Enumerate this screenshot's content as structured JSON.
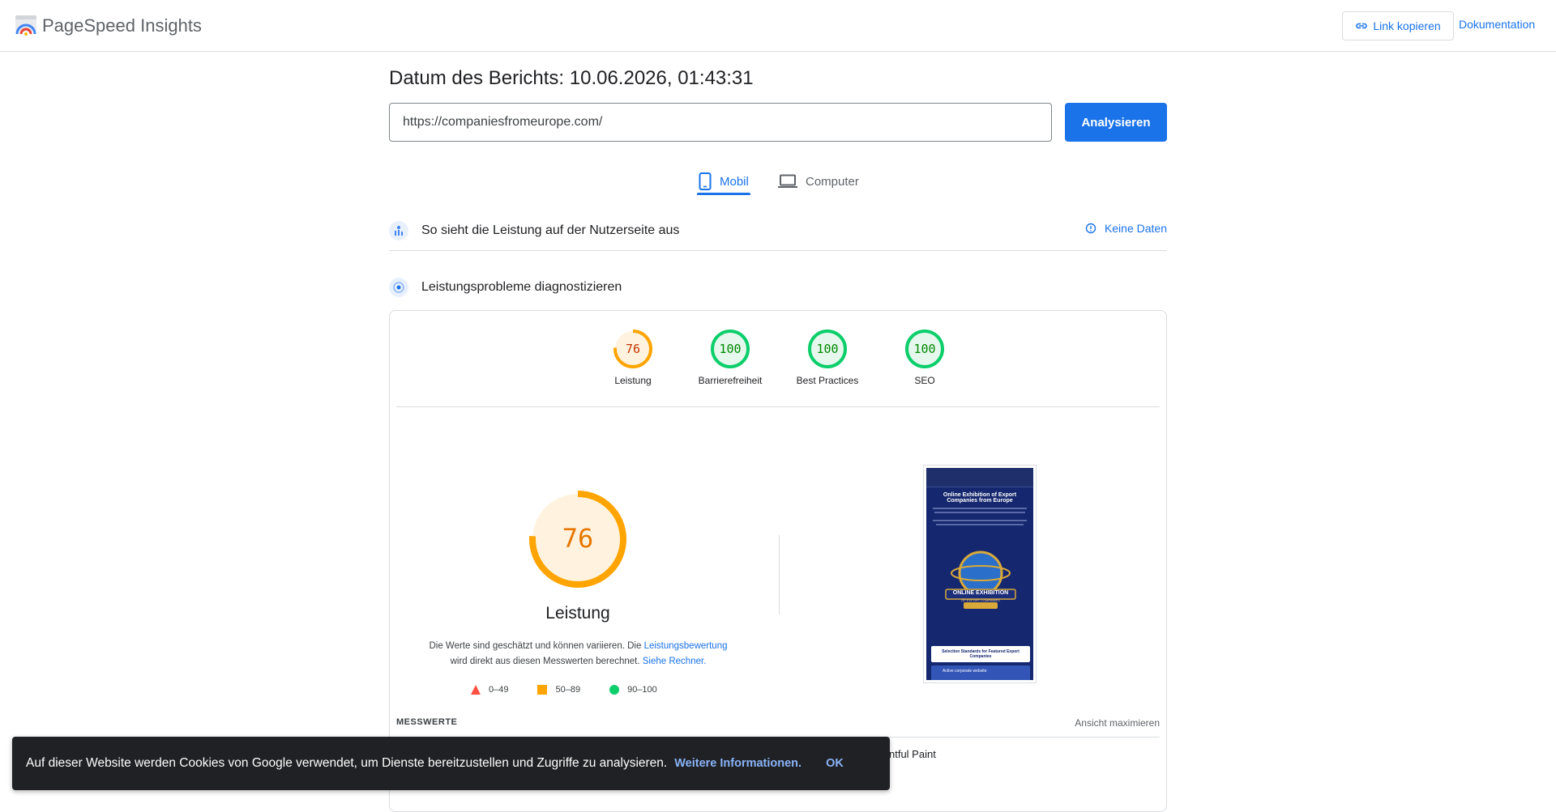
{
  "app": {
    "title": "PageSpeed Insights"
  },
  "header": {
    "copy_link_label": "Link kopieren",
    "docs_label": "Dokumentation"
  },
  "report": {
    "date_label": "Datum des Berichts: 10.06.2026, 01:43:31"
  },
  "search": {
    "url_value": "https://companiesfromeurope.com/",
    "analyze_label": "Analysieren"
  },
  "tabs": [
    {
      "label": "Mobil",
      "active": true,
      "icon": "phone-icon"
    },
    {
      "label": "Computer",
      "active": false,
      "icon": "laptop-icon"
    }
  ],
  "field_data": {
    "title": "So sieht die Leistung auf der Nutzerseite aus",
    "no_data_label": "Keine Daten"
  },
  "lab": {
    "title": "Leistungsprobleme diagnostizieren"
  },
  "scores": [
    {
      "value": "76",
      "label": "Leistung",
      "fraction": 0.76,
      "color": "#ffa400",
      "fill": "#fff3e0",
      "text_color": "#c33300"
    },
    {
      "value": "100",
      "label": "Barrierefreiheit",
      "fraction": 1.0,
      "color": "#0cce6b",
      "fill": "#e6f8ed",
      "text_color": "#008800"
    },
    {
      "value": "100",
      "label": "Best Practices",
      "fraction": 1.0,
      "color": "#0cce6b",
      "fill": "#e6f8ed",
      "text_color": "#008800"
    },
    {
      "value": "100",
      "label": "SEO",
      "fraction": 1.0,
      "color": "#0cce6b",
      "fill": "#e6f8ed",
      "text_color": "#008800"
    }
  ],
  "performance": {
    "score": "76",
    "fraction": 0.76,
    "label": "Leistung",
    "desc_part1": "Die Werte sind geschätzt und können variieren. Die ",
    "desc_link1": "Leistungsbewertung",
    "desc_part2": "wird direkt aus diesen Messwerten berechnet.",
    "desc_link2": "Siehe Rechner."
  },
  "legend": [
    {
      "range": "0–49",
      "shape": "triangle",
      "color": "#ff4e42"
    },
    {
      "range": "50–89",
      "shape": "square",
      "color": "#ffa400"
    },
    {
      "range": "90–100",
      "shape": "circle",
      "color": "#0cce6b"
    }
  ],
  "screenshot": {
    "heading": "Online Exhibition of Export Companies from Europe",
    "emblem_text": "ONLINE EXHIBITION",
    "emblem_sub": "OF EXPORT COMPANIES",
    "card_text": "Selection Standards for Featured Export Companies",
    "item_text": "Active corporate website"
  },
  "metrics": {
    "section_label": "MESSWERTE",
    "maximize_label": "Ansicht maximieren",
    "visible_metric": "ntful Paint"
  },
  "cookie": {
    "text": "Auf dieser Website werden Cookies von Google verwendet, um Dienste bereitzustellen und Zugriffe zu analysieren.",
    "more_label": "Weitere Informationen.",
    "ok_label": "OK"
  }
}
